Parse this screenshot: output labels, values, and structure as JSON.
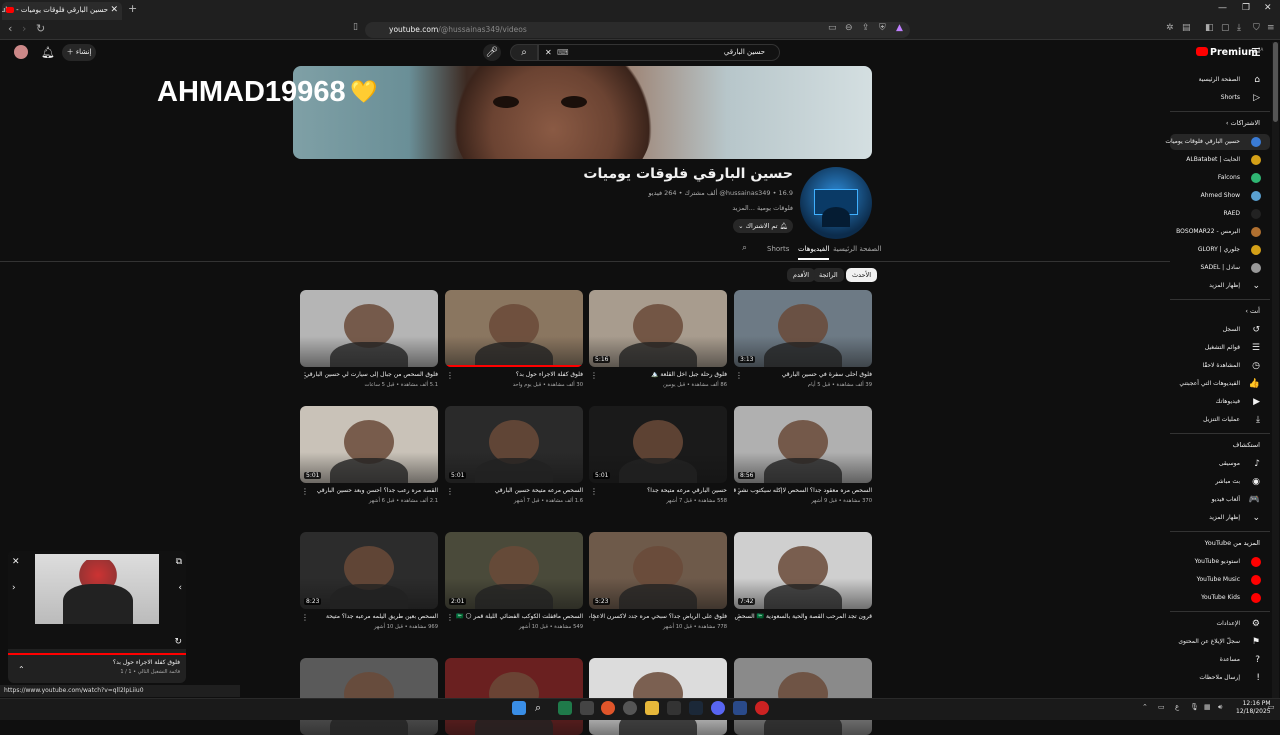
{
  "browser": {
    "tab_title": "حسين البارقي فلوقات يوميات - YouTube",
    "tab_close": "✕",
    "new_tab": "+",
    "url_host": "youtube.com",
    "url_path": "/@hussainas349/videos"
  },
  "yt_header": {
    "create_label": "إنشاء",
    "search_value": "حسين البارقي",
    "logo_text": "Premium",
    "logo_badge": "SA"
  },
  "overlay": {
    "watermark": "AHMAD19968",
    "heart": "💛"
  },
  "channel": {
    "name": "حسين البارقي فلوقات يوميات",
    "meta": "‎@hussainas349‎ • 16.9 ألف مشترك • 264 فيديو",
    "description": "فلوقات يومية ...المزيد",
    "subscribe_label": "تم الاشتراك",
    "tabs": [
      "الصفحة الرئيسية",
      "الفيديوهات",
      "Shorts"
    ],
    "active_tab": "الفيديوهات",
    "chips": [
      "الأحدث",
      "الرائجة",
      "الأقدم"
    ]
  },
  "videos": [
    {
      "title": "فلوق أحلى سفرة في حسين البارقي",
      "meta": "39 ألف مشاهدة • قبل 5 أيام",
      "dur": "3:13",
      "bg": "#6d7a85"
    },
    {
      "title": "فلوق رحلة جبل اخل القلعة 🏔️",
      "meta": "86 ألف مشاهدة • قبل يومين",
      "dur": "5:16",
      "bg": "#a89c8e"
    },
    {
      "title": "فلوق كفلة الاجراء حول بد؟",
      "meta": "30 ألف مشاهدة • قبل يوم واحد",
      "dur": "",
      "bg": "#8a7660"
    },
    {
      "title": "فلوق السحص من جبال إلى سيارت لي حسين البارقي",
      "meta": "5.1 ألف مشاهدة • قبل 5 ساعات",
      "dur": "",
      "bg": "#b5b5b5"
    },
    {
      "title": "السحص مره معقود جدا؟ السحص لاإكله سيكتوب نشر قفل جرس نتيبة",
      "meta": "370 مشاهدة • قبل 9 أشهر",
      "dur": "8:56",
      "bg": "#b0b0b0"
    },
    {
      "title": "حسين البارقي مرعه متيحة جدا؟",
      "meta": "558 مشاهدة • قبل 7 أشهر",
      "dur": "5:01",
      "bg": "#1a1a1a"
    },
    {
      "title": "السحص مرعه متيحة حسين البارقي",
      "meta": "1.6 ألف مشاهدة • قبل 7 أشهر",
      "dur": "5:01",
      "bg": "#2a2a2a"
    },
    {
      "title": "القصة مره رعب جدا؟ أحسن وبعد حسين البارقي",
      "meta": "2.1 ألف مشاهدة • قبل 6 أشهر",
      "dur": "5:01",
      "bg": "#c9c2b8"
    },
    {
      "title": "قرون تجد المرحب القصة والحية بالسعودية 🇸🇦 السحص حسين البارقي",
      "meta": "",
      "dur": "7:42",
      "bg": "#cfcfcf"
    },
    {
      "title": "فلوق على الرياض جدا؟ سبحي مره جدد لاكسرن الاعجاب لايكه سيكتوب قفل جرس نتيبة",
      "meta": "778 مشاهدة • قبل 10 أشهر",
      "dur": "5:23",
      "bg": "#6e5a4a"
    },
    {
      "title": "السحص ماقفلت الكوكب الفضائي الليلة قمر 🌕 🇸🇦",
      "meta": "549 مشاهدة • قبل 10 أشهر",
      "dur": "2:01",
      "bg": "#4a4a3a"
    },
    {
      "title": "السحص بعين طريق اليلمه مرعبه جدا؟ متيحة",
      "meta": "969 مشاهدة • قبل 10 أشهر",
      "dur": "8:23",
      "bg": "#2c2c2c"
    },
    {
      "title": "",
      "meta": "",
      "dur": "",
      "bg": "#8a8a8a"
    },
    {
      "title": "",
      "meta": "",
      "dur": "",
      "bg": "#dcdcdc"
    },
    {
      "title": "",
      "meta": "",
      "dur": "",
      "bg": "#6a2020"
    },
    {
      "title": "",
      "meta": "",
      "dur": "",
      "bg": "#5a5a5a"
    }
  ],
  "sidebar": {
    "top": [
      {
        "label": "الصفحة الرئيسية",
        "icon": "⌂"
      },
      {
        "label": "Shorts",
        "icon": "▷"
      }
    ],
    "subs_head": "الاشتراكات ›",
    "subs": [
      {
        "label": "حسين البارقي فلوقات يوميات",
        "color": "#3a7bd5"
      },
      {
        "label": "الحايث | ALBatabet",
        "color": "#d4a017"
      },
      {
        "label": "Falcons",
        "color": "#2fb673"
      },
      {
        "label": "Ahmed Show",
        "color": "#5aa0d0"
      },
      {
        "label": "RAED",
        "color": "#222"
      },
      {
        "label": "البرمس - BOSOMAR22",
        "color": "#b07030"
      },
      {
        "label": "جلوري | GLORY",
        "color": "#d4a017"
      },
      {
        "label": "سادل | SADEL",
        "color": "#999"
      }
    ],
    "subs_more": "إظهار المزيد",
    "you_head": "أنت ›",
    "you": [
      {
        "label": "السجل",
        "icon": "↺"
      },
      {
        "label": "قوائم التشغيل",
        "icon": "☰"
      },
      {
        "label": "المشاهدة لاحقًا",
        "icon": "◷"
      },
      {
        "label": "الفيديوهات التي أعجبتني",
        "icon": "👍"
      },
      {
        "label": "فيديوهاتك",
        "icon": "▶"
      },
      {
        "label": "عمليات التنزيل",
        "icon": "⤓"
      }
    ],
    "explore_head": "استكشاف",
    "explore": [
      {
        "label": "موسيقى",
        "icon": "♪"
      },
      {
        "label": "بث مباشر",
        "icon": "◉"
      },
      {
        "label": "ألعاب فيديو",
        "icon": "🎮"
      },
      {
        "label": "إظهار المزيد",
        "icon": "⌄"
      }
    ],
    "more_head": "المزيد من YouTube",
    "more": [
      {
        "label": "استوديو YouTube",
        "color": "#f00"
      },
      {
        "label": "YouTube Music",
        "color": "#f00"
      },
      {
        "label": "YouTube Kids",
        "color": "#f00"
      }
    ],
    "settings": [
      {
        "label": "الإعدادات",
        "icon": "⚙"
      },
      {
        "label": "سجلّ الإبلاغ عن المحتوى",
        "icon": "⚑"
      },
      {
        "label": "مساعدة",
        "icon": "?"
      },
      {
        "label": "إرسال ملاحظات",
        "icon": "!"
      }
    ]
  },
  "miniplayer": {
    "title": "فلوق كفلة الاجراء حول بد؟",
    "subtitle": "قائمة التشغيل التالي • 1 / 1"
  },
  "status_url": "https://www.youtube.com/watch?v=qll2lpLiiu0",
  "clock": {
    "time": "12:16 PM",
    "date": "12/18/2025"
  }
}
